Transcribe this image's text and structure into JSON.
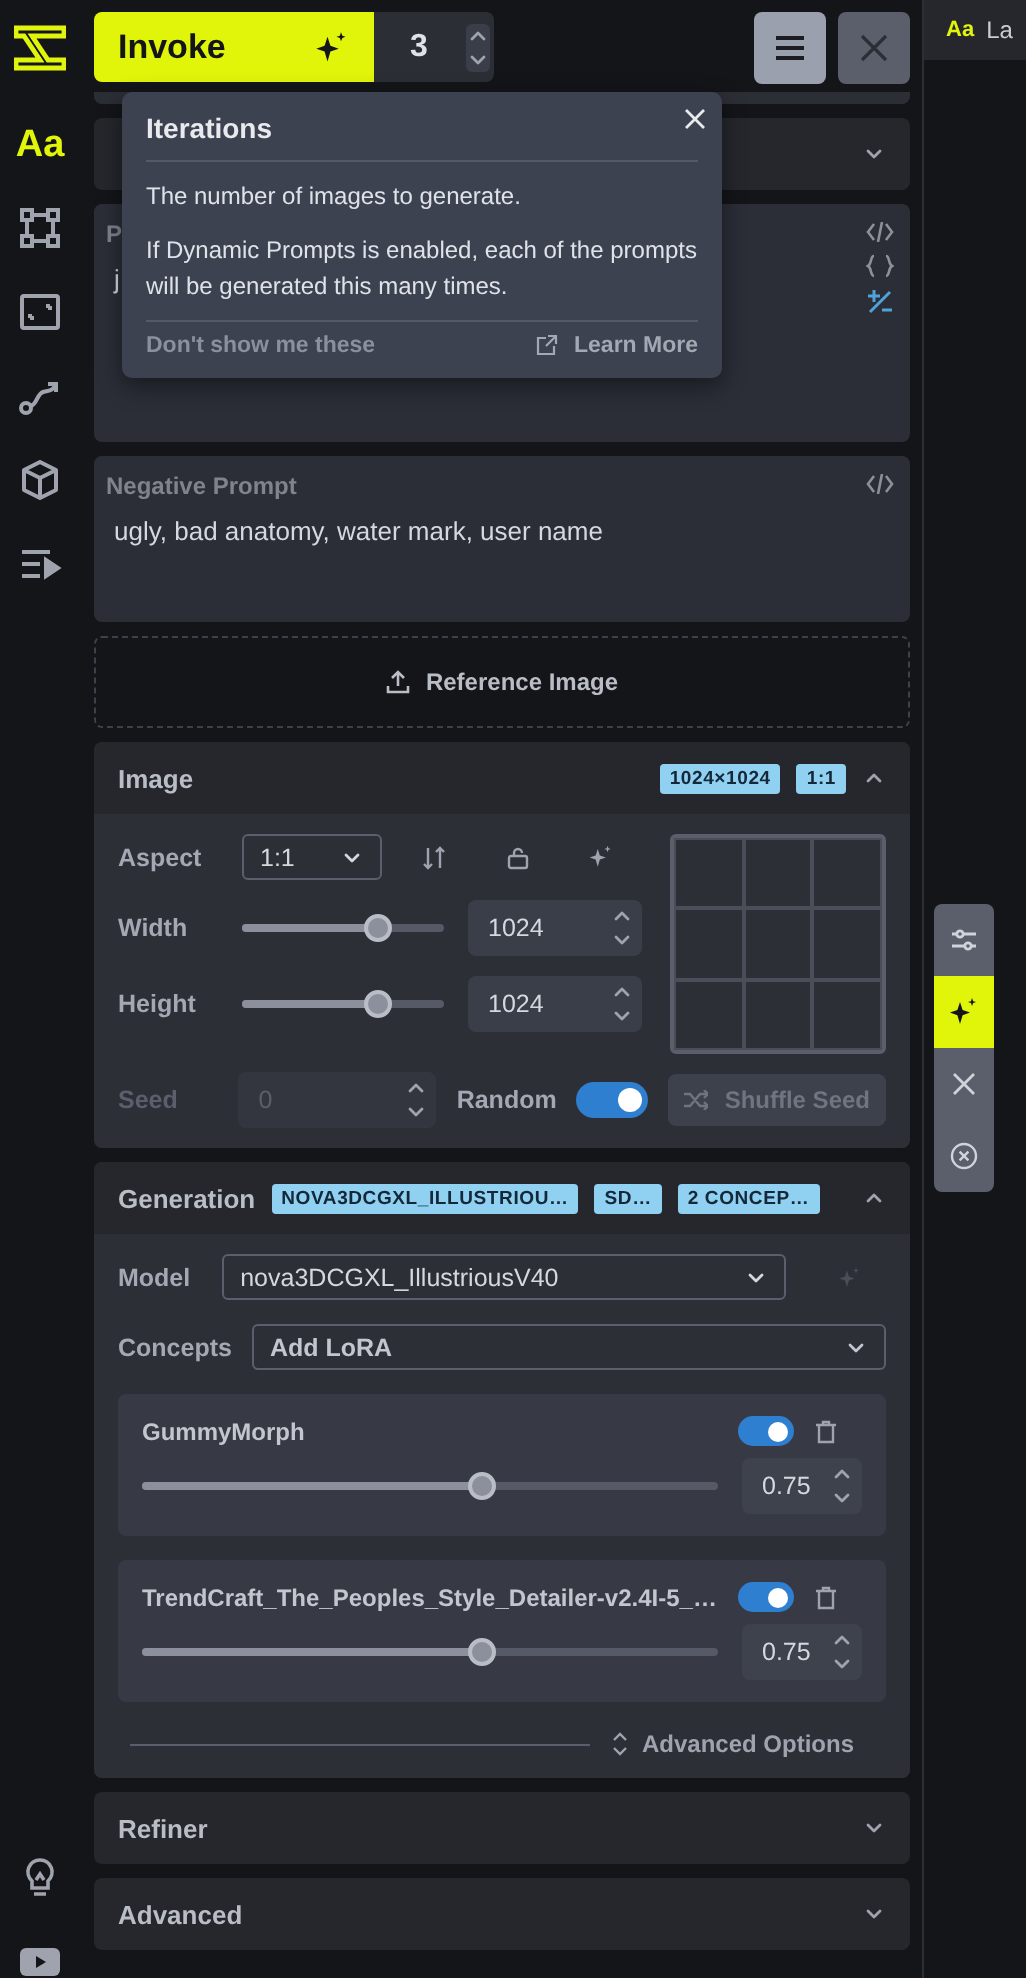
{
  "toolbar": {
    "invoke_label": "Invoke",
    "iterations": "3"
  },
  "sidebar": {
    "items": [
      {
        "kind": "text",
        "glyph": "Aa",
        "selected": true
      },
      {
        "kind": "nodes",
        "selected": false
      },
      {
        "kind": "resize",
        "selected": false
      },
      {
        "kind": "path",
        "selected": false
      },
      {
        "kind": "cube",
        "selected": false
      },
      {
        "kind": "queue",
        "selected": false
      }
    ],
    "bottom_items": [
      {
        "kind": "bulb"
      },
      {
        "kind": "video"
      }
    ]
  },
  "collapsed_section": {
    "expanded": false
  },
  "prompt": {
    "label": "P",
    "lines": [
      "j"
    ]
  },
  "negative_prompt": {
    "label": "Negative Prompt",
    "value": "ugly, bad anatomy, water mark, user name"
  },
  "reference_image": {
    "label": "Reference Image"
  },
  "image_section": {
    "title": "Image",
    "expanded": true,
    "badges": [
      "1024×1024",
      "1:1"
    ],
    "aspect": {
      "label": "Aspect",
      "value": "1:1"
    },
    "sizes": [
      {
        "label": "Width",
        "value": "1024",
        "level": 0.67
      },
      {
        "label": "Height",
        "value": "1024",
        "level": 0.67
      }
    ],
    "seed": {
      "label": "Seed",
      "value": "0",
      "disabled": true
    },
    "random": {
      "label": "Random",
      "on": true
    },
    "shuffle": {
      "label": "Shuffle Seed",
      "disabled": true
    }
  },
  "generation": {
    "title": "Generation",
    "expanded": true,
    "badges": [
      "NOVA3DCGXL_ILLUSTRIOU…",
      "SD…",
      "2 CONCEP…"
    ],
    "model_label": "Model",
    "model": "nova3DCGXL_IllustriousV40",
    "concepts_label": "Concepts",
    "concepts_placeholder": "Add LoRA",
    "loras": [
      {
        "name": "GummyMorph",
        "on": true,
        "level": 0.59,
        "value": "0.75"
      },
      {
        "name": "TrendCraft_The_Peoples_Style_Detailer-v2.4I-5_…",
        "on": true,
        "level": 0.59,
        "value": "0.75"
      }
    ],
    "advanced_options": "Advanced Options"
  },
  "sections": [
    {
      "title": "Refiner",
      "expanded": false
    },
    {
      "title": "Advanced",
      "expanded": false
    }
  ],
  "popover": {
    "title": "Iterations",
    "paragraphs": [
      "The number of images to generate.",
      "If Dynamic Prompts is enabled, each of the prompts will be generated this many times."
    ],
    "dismiss": "Don't show me these",
    "learn_more": "Learn More"
  },
  "right_panel": {
    "tab_glyph": "Aa",
    "tab_label": "La"
  },
  "floating_toolbar": [
    {
      "kind": "settings",
      "selected": false
    },
    {
      "kind": "sparkle",
      "selected": true
    },
    {
      "kind": "close",
      "selected": false
    },
    {
      "kind": "cancel",
      "selected": false
    }
  ]
}
